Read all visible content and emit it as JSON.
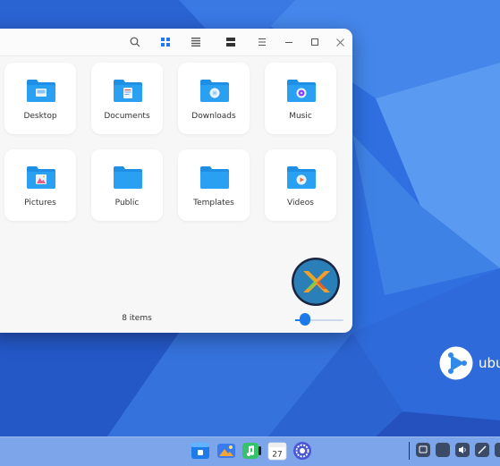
{
  "desktop": {
    "brand_text": "ubu"
  },
  "window": {
    "toolbar": {
      "search_icon": "search-icon",
      "icon_view_icon": "grid-view-icon",
      "list_view_icon": "list-view-icon",
      "compact_view_icon": "compact-view-icon",
      "menu_icon": "menu-icon",
      "minimize_icon": "minimize-icon",
      "maximize_icon": "maximize-icon",
      "close_icon": "close-icon",
      "active_view": "grid-view-icon"
    },
    "folders": [
      {
        "label": "Desktop",
        "emblem": "desktop"
      },
      {
        "label": "Documents",
        "emblem": "documents"
      },
      {
        "label": "Downloads",
        "emblem": "downloads"
      },
      {
        "label": "Music",
        "emblem": "music"
      },
      {
        "label": "Pictures",
        "emblem": "pictures"
      },
      {
        "label": "Public",
        "emblem": "none"
      },
      {
        "label": "Templates",
        "emblem": "none"
      },
      {
        "label": "Videos",
        "emblem": "videos"
      }
    ],
    "status": {
      "item_count": "8 items",
      "zoom_level": 0.2
    }
  },
  "dock": {
    "apps": [
      "file-manager-icon",
      "image-viewer-icon",
      "music-player-icon",
      "calendar-icon",
      "settings-icon"
    ],
    "calendar_day": "27",
    "tray": [
      "show-desktop-icon",
      "multitasking-icon",
      "volume-icon",
      "pen-icon",
      "power-icon"
    ]
  },
  "colors": {
    "accent": "#1e7ae8",
    "folder": "#1f8fe6",
    "wallpaper": "#2f6fe0"
  }
}
